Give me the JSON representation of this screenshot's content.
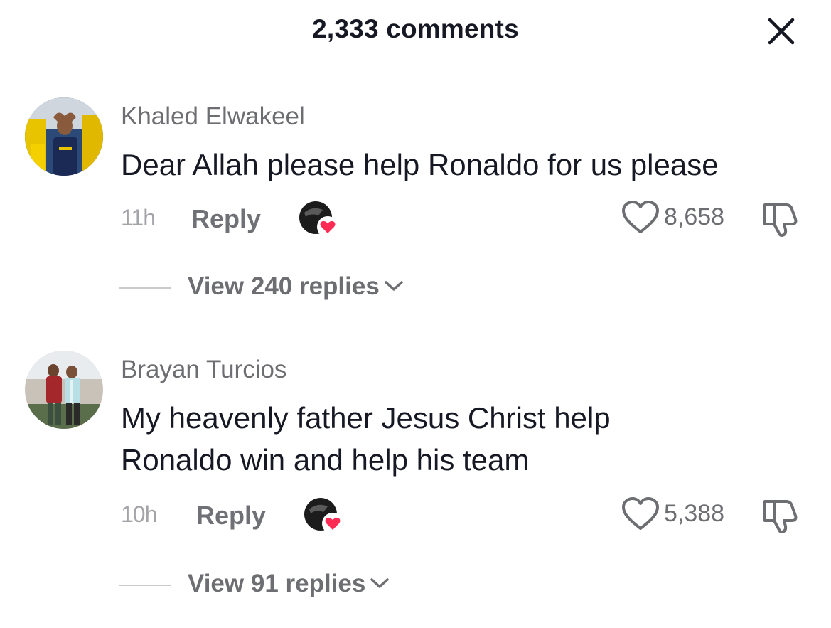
{
  "header": {
    "title": "2,333 comments",
    "close_icon": "close-icon"
  },
  "comments": [
    {
      "username": "Khaled Elwakeel",
      "text": "Dear Allah please help Ronaldo for us please",
      "time": "11h",
      "reply_label": "Reply",
      "like_count": "8,658",
      "view_replies_label": "View 240 replies",
      "avatar_colors": [
        "#f2c700",
        "#1a2550"
      ],
      "creator_liked": true
    },
    {
      "username": "Brayan Turcios",
      "text": "My heavenly father Jesus Christ help Ronaldo win and help his team",
      "time": "10h",
      "reply_label": "Reply",
      "like_count": "5,388",
      "view_replies_label": "View 91 replies",
      "avatar_colors": [
        "#8a2a2a",
        "#cfe3e6"
      ],
      "creator_liked": true
    }
  ],
  "colors": {
    "heart_badge": "#fe2c55",
    "username": "#6d6e72",
    "text": "#161823"
  }
}
